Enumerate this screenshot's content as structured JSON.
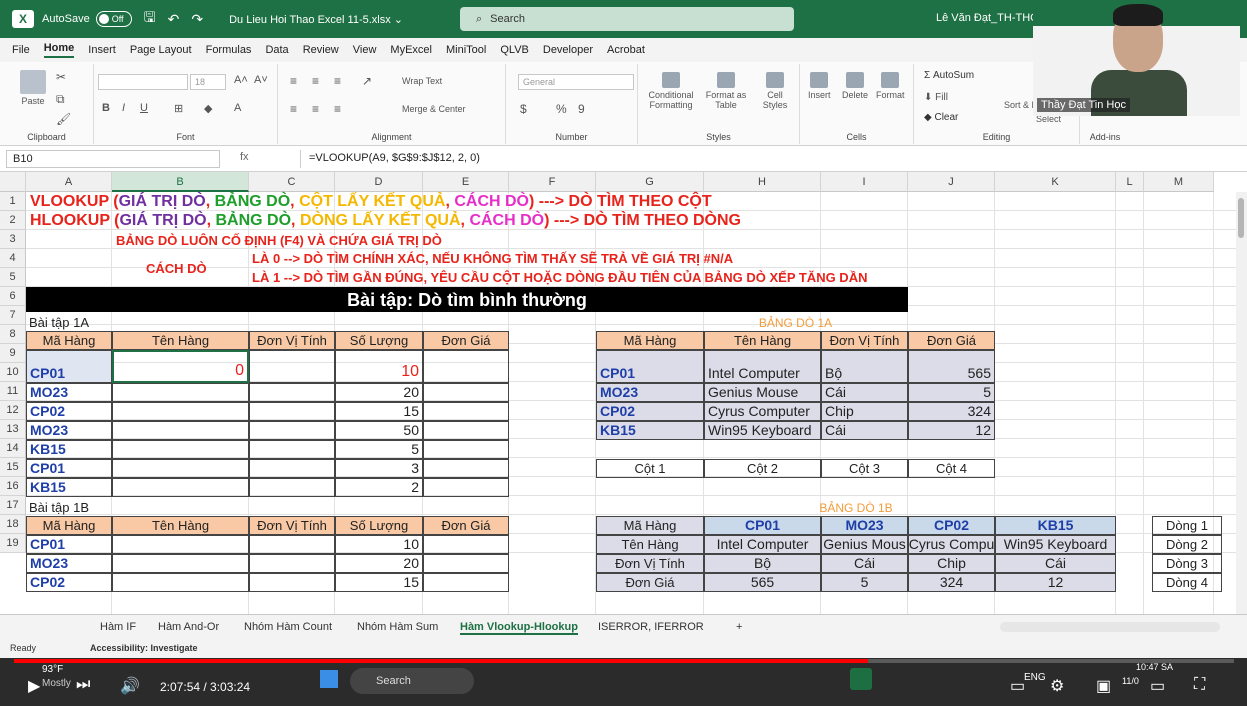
{
  "titlebar": {
    "app_logo": "X",
    "autosave_label": "AutoSave",
    "autosave_state": "Off",
    "filename": "Du Lieu Hoi Thao Excel 11-5.xlsx ⌄",
    "search_placeholder": "Search",
    "user": "Lê Văn Đạt_TH-THCS-T"
  },
  "menu": [
    "File",
    "Home",
    "Insert",
    "Page Layout",
    "Formulas",
    "Data",
    "Review",
    "View",
    "MyExcel",
    "MiniTool",
    "QLVB",
    "Developer",
    "Acrobat"
  ],
  "ribbon": {
    "clipboard": "Clipboard",
    "paste": "Paste",
    "font": "Font",
    "font_size": "18",
    "alignment": "Alignment",
    "wrap_text": "Wrap Text",
    "merge_center": "Merge & Center",
    "number": "Number",
    "number_format": "General",
    "styles": "Styles",
    "conditional": "Conditional Formatting",
    "format_table": "Format as Table",
    "cell_styles": "Cell Styles",
    "cells": "Cells",
    "insert": "Insert",
    "delete": "Delete",
    "format": "Format",
    "editing": "Editing",
    "autosum": "AutoSum",
    "fill": "Fill",
    "clear": "Clear",
    "sort_filter": "Sort & Filter",
    "find_select": "Select",
    "addins": "Add-ins"
  },
  "formula_bar": {
    "name_box": "B10",
    "fx": "fx",
    "formula": "=VLOOKUP(A9, $G$9:$J$12, 2, 0)"
  },
  "columns": [
    "A",
    "B",
    "C",
    "D",
    "E",
    "F",
    "G",
    "H",
    "I",
    "J",
    "K",
    "L",
    "M"
  ],
  "rows": [
    "1",
    "2",
    "3",
    "4",
    "5",
    "6",
    "7",
    "8",
    "9",
    "10",
    "11",
    "12",
    "13",
    "14",
    "15",
    "16",
    "17",
    "18",
    "19"
  ],
  "sheet": {
    "r1": [
      {
        "t": "VLOOKUP (",
        "c": "#e8231b"
      },
      {
        "t": "GIÁ TRỊ DÒ",
        "c": "#7030a0"
      },
      {
        "t": ", ",
        "c": "#e8231b"
      },
      {
        "t": "BẢNG DÒ",
        "c": "#1e9e2a"
      },
      {
        "t": ", ",
        "c": "#e8231b"
      },
      {
        "t": "CỘT LẤY KẾT QUẢ",
        "c": "#f5b800"
      },
      {
        "t": ", ",
        "c": "#e8231b"
      },
      {
        "t": "CÁCH DÒ",
        "c": "#e62ec8"
      },
      {
        "t": ") ---> DÒ TÌM THEO CỘT",
        "c": "#e8231b"
      }
    ],
    "r2": [
      {
        "t": "HLOOKUP (",
        "c": "#e8231b"
      },
      {
        "t": "GIÁ TRỊ DÒ",
        "c": "#7030a0"
      },
      {
        "t": ", ",
        "c": "#e8231b"
      },
      {
        "t": "BẢNG DÒ",
        "c": "#1e9e2a"
      },
      {
        "t": ", ",
        "c": "#e8231b"
      },
      {
        "t": "DÒNG LẤY KẾT QUẢ",
        "c": "#f5b800"
      },
      {
        "t": ", ",
        "c": "#e8231b"
      },
      {
        "t": "CÁCH DÒ",
        "c": "#e62ec8"
      },
      {
        "t": ") ---> DÒ TÌM THEO DÒNG",
        "c": "#e8231b"
      }
    ],
    "r3": "BẢNG DÒ LUÔN CỐ ĐỊNH (F4) VÀ CHỨA GIÁ TRỊ DÒ",
    "cach_do": "CÁCH DÒ",
    "r4": "LÀ 0 --> DÒ TÌM CHÍNH XÁC, NẾU KHÔNG TÌM THẤY SẼ TRẢ VỀ GIÁ TRỊ #N/A",
    "r5": "LÀ 1 --> DÒ TÌM GẦN ĐÚNG, YÊU CẦU CỘT HOẶC DÒNG ĐẦU TIÊN CỦA BẢNG DÒ XẾP TĂNG DẦN",
    "r6": "Bài tập:  Dò tìm bình thường",
    "bt1a": "Bài tập 1A",
    "bt1b": "Bài tập 1B",
    "headers": [
      "Mã Hàng",
      "Tên Hàng",
      "Đơn Vị Tính",
      "Số Lượng",
      "Đơn Giá"
    ],
    "table1a": [
      {
        "ma": "CP01",
        "ten": "0",
        "sl": "10"
      },
      {
        "ma": "MO23",
        "ten": "",
        "sl": "20"
      },
      {
        "ma": "CP02",
        "ten": "",
        "sl": "15"
      },
      {
        "ma": "MO23",
        "ten": "",
        "sl": "50"
      },
      {
        "ma": "KB15",
        "ten": "",
        "sl": "5"
      },
      {
        "ma": "CP01",
        "ten": "",
        "sl": "3"
      },
      {
        "ma": "KB15",
        "ten": "",
        "sl": "2"
      }
    ],
    "table1b": [
      {
        "ma": "CP01",
        "sl": "10"
      },
      {
        "ma": "MO23",
        "sl": "20"
      },
      {
        "ma": "CP02",
        "sl": "15"
      }
    ],
    "bang_do_1a_title": "BẢNG DÒ 1A",
    "bang_do_1a_headers": [
      "Mã Hàng",
      "Tên Hàng",
      "Đơn Vị Tính",
      "Đơn Giá"
    ],
    "bang_do_1a": [
      [
        "CP01",
        "Intel Computer",
        "Bộ",
        "565"
      ],
      [
        "MO23",
        "Genius Mouse",
        "Cái",
        "5"
      ],
      [
        "CP02",
        "Cyrus Computer",
        "Chip",
        "324"
      ],
      [
        "KB15",
        "Win95 Keyboard",
        "Cái",
        "12"
      ]
    ],
    "cot_labels": [
      "Cột 1",
      "Cột 2",
      "Cột 3",
      "Cột 4"
    ],
    "bang_do_1b_title": "BẢNG DÒ 1B",
    "bang_do_1b_rowlabels": [
      "Mã Hàng",
      "Tên Hàng",
      "Đơn Vị Tính",
      "Đơn Giá"
    ],
    "bang_do_1b": [
      [
        "CP01",
        "MO23",
        "CP02",
        "KB15"
      ],
      [
        "Intel Computer",
        "Genius Mous",
        "Cyrus Compu",
        "Win95 Keyboard"
      ],
      [
        "Bộ",
        "Cái",
        "Chip",
        "Cái"
      ],
      [
        "565",
        "5",
        "324",
        "12"
      ]
    ],
    "dong_labels": [
      "Dòng 1",
      "Dòng 2",
      "Dòng 3",
      "Dòng 4"
    ]
  },
  "tabs": [
    "Hàm IF",
    "Hàm And-Or",
    "Nhóm Hàm Count",
    "Nhóm Hàm Sum",
    "Hàm Vlookup-Hlookup",
    "ISERROR, IFERROR",
    "+"
  ],
  "status": {
    "ready": "Ready",
    "accessibility": "Accessibility: Investigate"
  },
  "video": {
    "time": "2:07:54 / 3:03:24",
    "progress": 0.7
  },
  "taskbar": {
    "weather": "93°F",
    "weather_sub": "Mostly",
    "search": "Search",
    "lang": "ENG",
    "clock": "10:47 SA",
    "date": "11/0"
  },
  "webcam": {
    "label": "Thầy Đạt Tin Học"
  }
}
